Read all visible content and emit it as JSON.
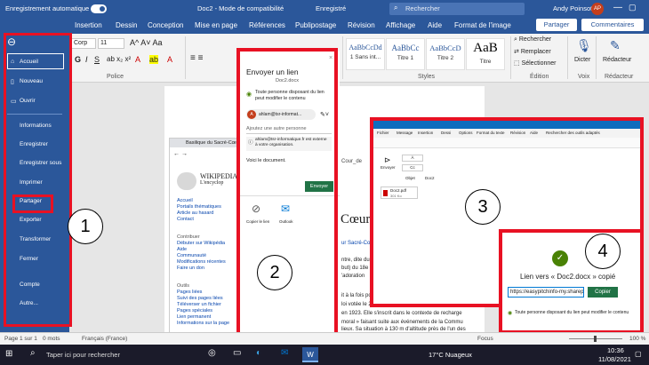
{
  "titlebar": {
    "autosave": "Enregistrement automatique",
    "filename": "Doc2 - Mode de compatibilité",
    "saved": "Enregistré",
    "search_placeholder": "Rechercher",
    "user": "Andy Poinsot",
    "initials": "AP"
  },
  "tabs": [
    "Insertion",
    "Dessin",
    "Conception",
    "Mise en page",
    "Références",
    "Publipostage",
    "Révision",
    "Affichage",
    "Aide",
    "Format de l'image"
  ],
  "share_label": "Partager",
  "comments_label": "Commentaires",
  "ribbon": {
    "font_name": "Corp",
    "font_size": "11",
    "group_police": "Police",
    "group_styles": "Styles",
    "group_edition": "Édition",
    "group_voix": "Voix",
    "group_redacteur": "Rédacteur",
    "styles": [
      {
        "sample": "AaBbCcDd",
        "name": "1 Sans int..."
      },
      {
        "sample": "AaBbCc",
        "name": "Titre 1"
      },
      {
        "sample": "AaBbCcD",
        "name": "Titre 2"
      },
      {
        "sample": "AaB",
        "name": "Titre"
      }
    ],
    "rechercher": "Rechercher",
    "remplacer": "Remplacer",
    "selectionner": "Sélectionner",
    "dicter": "Dicter",
    "redacteur": "Rédacteur"
  },
  "backstage": {
    "items": [
      "Accueil",
      "Nouveau",
      "Ouvrir",
      "Informations",
      "Enregistrer",
      "Enregistrer sous",
      "Imprimer",
      "Partager",
      "Exporter",
      "Transformer",
      "Fermer",
      "Compte",
      "Autre..."
    ]
  },
  "share_dialog": {
    "title": "Envoyer un lien",
    "file": "Doc2.docx",
    "permission": "Toute personne disposant du lien peut modifier le contenu",
    "recipient_initial": "A",
    "recipient": "ahlam@tsr-informat...",
    "add_placeholder": "Ajoutez une autre personne",
    "warning": "ahlam@tsr-informatique.fr est externe à votre organisation.",
    "message": "Voici le document.",
    "send": "Envoyer",
    "copy_link": "Copier le lien",
    "outlook": "Outlook"
  },
  "browser": {
    "tab_title": "Basilique du Sacré-Cœur",
    "wiki_title": "WIKIPEDIA",
    "wiki_sub": "L'encyclop",
    "links": [
      "Accueil",
      "Portails thématiques",
      "Article au hasard",
      "Contact"
    ],
    "contrib_header": "Contribuer",
    "contrib_links": [
      "Débuter sur Wikipédia",
      "Aide",
      "Communauté",
      "Modifications récentes",
      "Faire un don"
    ],
    "tools_header": "Outils",
    "tools_links": [
      "Pages liées",
      "Suivi des pages liées",
      "Téléverser un fichier",
      "Pages spéciales",
      "Lien permanent",
      "Informations sur la page"
    ]
  },
  "doc_text": {
    "heading": "Cœur d",
    "url_fragment": "Cour_de",
    "l1": "ur Sacré-Cœu",
    "l2": "ntre, dite du",
    "l3": "but) du 18e",
    "l4": "'adoration",
    "p1": "it à la fois politique et culturel, suit l'après-guerre de 187",
    "p2": "loi votée le 24 juillet 1873 par l'Assemblée nationale de",
    "p3": "en 1923. Elle s'inscrit dans le contexte de recharge",
    "p4": "moral » faisant suite aux événements de la Commu",
    "p5": "lieux. Sa situation à 130 m d'altitude près de l'un des"
  },
  "outlook": {
    "tabs": [
      "Fichier",
      "Message",
      "Insertion",
      "Dessi",
      "Options",
      "Format du texte",
      "Révision",
      "Aide"
    ],
    "search": "Rechercher des outils adaptés",
    "send": "Envoyer",
    "a_label": "À",
    "cc_label": "Cc",
    "objet_label": "Objet",
    "objet_value": "Doc2",
    "attach_name": "Doc2.pdf",
    "attach_size": "301 Ko"
  },
  "copied": {
    "message": "Lien vers « Doc2.docx » copié",
    "url": "https://easypitchinfo-my.sharep",
    "copy": "Copier",
    "permission": "Toute personne disposant du lien peut modifier le contenu"
  },
  "numbers": [
    "1",
    "2",
    "3",
    "4"
  ],
  "status": {
    "page": "Page 1 sur 1",
    "words": "0 mots",
    "lang": "Français (France)",
    "focus": "Focus",
    "zoom": "100 %"
  },
  "taskbar": {
    "search": "Taper ici pour rechercher",
    "weather": "17°C Nuageux",
    "time": "10:36",
    "date": "11/08/2021"
  },
  "colors": {
    "word_blue": "#2b579a",
    "highlight_red": "#e81123",
    "success_green": "#498205"
  }
}
